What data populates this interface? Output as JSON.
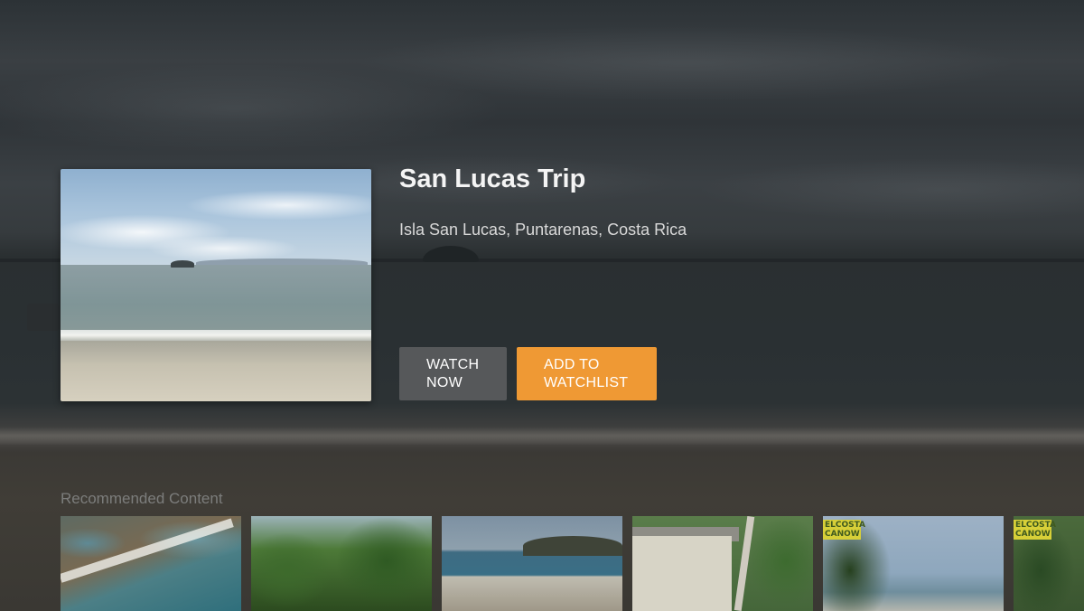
{
  "hero": {
    "title": "San Lucas Trip",
    "subtitle": "Isla San Lucas, Puntarenas, Costa Rica",
    "thumbnail_alt": "Beach at Isla San Lucas",
    "watch_line1": "WATCH",
    "watch_line2": "NOW",
    "add_line1": "ADD TO",
    "add_line2": "WATCHLIST"
  },
  "recommended": {
    "heading": "Recommended Content",
    "tiles": [
      {
        "name": "aerial-beach"
      },
      {
        "name": "jungle-river"
      },
      {
        "name": "shoreline-rocks"
      },
      {
        "name": "cabin-jungle"
      },
      {
        "name": "el-costa-canow",
        "badge": "ELCOSTA CANOW"
      },
      {
        "name": "el-costa-canow-2",
        "badge": "ELCOSTA CANOW"
      }
    ]
  },
  "colors": {
    "accent": "#ef9934",
    "secondary_button": "#56585a",
    "title_text": "#f4f4f4",
    "muted_text": "#7c7d7c"
  }
}
